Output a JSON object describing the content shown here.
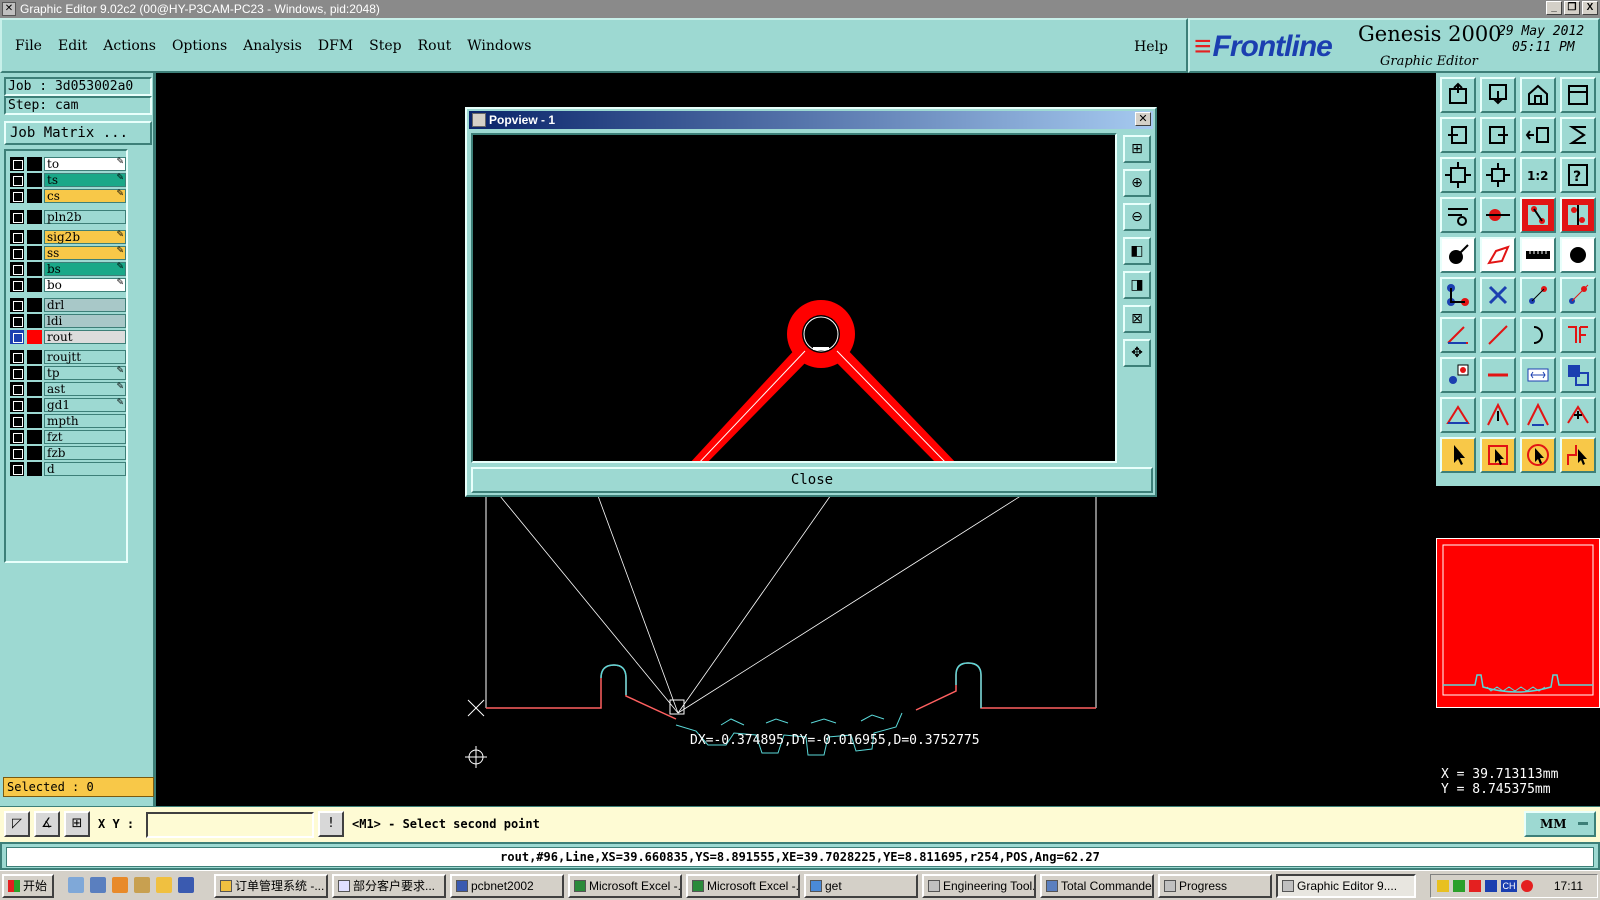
{
  "window": {
    "title": "Graphic Editor 9.02c2 (00@HY-P3CAM-PC23 - Windows, pid:2048)",
    "controls": [
      "_",
      "❐",
      "X"
    ]
  },
  "menu": {
    "items": [
      "File",
      "Edit",
      "Actions",
      "Options",
      "Analysis",
      "DFM",
      "Step",
      "Rout",
      "Windows"
    ],
    "help": "Help"
  },
  "brand": {
    "logo": "Frontline",
    "product": "Genesis 2000",
    "subtitle": "Graphic Editor",
    "date": "29 May 2012",
    "time": "05:11 PM"
  },
  "left_panel": {
    "job": "Job : 3d053002a0",
    "step": "Step: cam",
    "job_matrix": "Job Matrix ...",
    "selected": "Selected : 0",
    "layers": [
      {
        "name": "to",
        "color": "#ffffff",
        "pen": true
      },
      {
        "name": "ts",
        "color": "#1aa888",
        "pen": true
      },
      {
        "name": "cs",
        "color": "#f8c848",
        "pen": true
      },
      {
        "name": "pln2b",
        "color": "#9dd9d2",
        "pen": false
      },
      {
        "name": "sig2b",
        "color": "#f8c848",
        "pen": true
      },
      {
        "name": "ss",
        "color": "#f8c848",
        "pen": true
      },
      {
        "name": "bs",
        "color": "#1aa888",
        "pen": true
      },
      {
        "name": "bo",
        "color": "#ffffff",
        "pen": true
      },
      {
        "name": "drl",
        "color": "#a8c8c8",
        "pen": false
      },
      {
        "name": "ldi",
        "color": "#a8c8c8",
        "pen": false
      },
      {
        "name": "rout",
        "color": "#dcdcdc",
        "pen": false,
        "active": true
      },
      {
        "name": "roujtt",
        "color": "#9dd9d2",
        "pen": false
      },
      {
        "name": "tp",
        "color": "#9dd9d2",
        "pen": true
      },
      {
        "name": "ast",
        "color": "#9dd9d2",
        "pen": true
      },
      {
        "name": "gd1",
        "color": "#9dd9d2",
        "pen": true
      },
      {
        "name": "mpth",
        "color": "#9dd9d2",
        "pen": false
      },
      {
        "name": "fzt",
        "color": "#9dd9d2",
        "pen": false
      },
      {
        "name": "fzb",
        "color": "#9dd9d2",
        "pen": false
      },
      {
        "name": "d",
        "color": "#9dd9d2",
        "pen": false
      }
    ]
  },
  "canvas": {
    "measurement": "DX=-0.374895,DY=-0.016955,D=0.3752775"
  },
  "popview": {
    "title": "Popview - 1",
    "close_label": "Close",
    "tool_icons": [
      "zoom-window-icon",
      "zoom-in-icon",
      "zoom-out-icon",
      "pan-left-icon",
      "pan-right-icon",
      "fit-all-icon",
      "fit-profile-icon"
    ]
  },
  "coords": {
    "x": "X = 39.713113mm",
    "y": "Y = 8.745375mm"
  },
  "command_bar": {
    "xy_label": "X Y :",
    "input_value": "",
    "prompt": "<M1> - Select second point",
    "units": "MM"
  },
  "status_line": "rout,#96,Line,XS=39.660835,YS=8.891555,XE=39.7028225,YE=8.811695,r254,POS,Ang=62.27",
  "taskbar": {
    "start": "开始",
    "tasks": [
      {
        "label": "订单管理系统 -...",
        "active": false
      },
      {
        "label": "部分客户要求...",
        "active": false
      },
      {
        "label": "pcbnet2002",
        "active": false
      },
      {
        "label": "Microsoft Excel -...",
        "active": false
      },
      {
        "label": "Microsoft Excel -...",
        "active": false
      },
      {
        "label": "get",
        "active": false
      },
      {
        "label": "Engineering Tool...",
        "active": false
      },
      {
        "label": "Total Commande...",
        "active": false
      },
      {
        "label": "Progress",
        "active": false
      },
      {
        "label": "Graphic Editor 9....",
        "active": true
      }
    ],
    "tray_lang": "CH",
    "clock": "17:11"
  },
  "colors": {
    "panel": "#9dd9d2",
    "rout": "#ff0000",
    "profile": "#ffffff",
    "selected_bg": "#f8c848"
  }
}
